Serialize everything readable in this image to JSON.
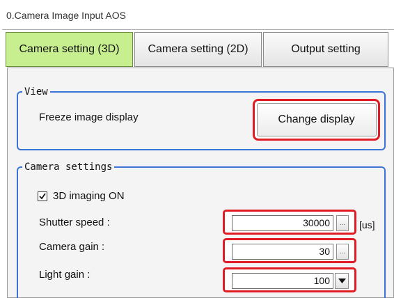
{
  "window": {
    "title": "0.Camera Image Input AOS"
  },
  "tabs": [
    {
      "label": "Camera setting (3D)",
      "active": true
    },
    {
      "label": "Camera setting (2D)",
      "active": false
    },
    {
      "label": "Output setting",
      "active": false
    }
  ],
  "view": {
    "legend": "View",
    "freeze_label": "Freeze image display",
    "change_display_label": "Change display"
  },
  "camera_settings": {
    "legend": "Camera settings",
    "imaging_3d_label": "3D imaging ON",
    "imaging_3d_checked": true,
    "shutter_speed_label": "Shutter speed :",
    "shutter_speed_value": "30000",
    "shutter_speed_unit": "[us]",
    "shutter_speed_button": "...",
    "camera_gain_label": "Camera gain :",
    "camera_gain_value": "30",
    "camera_gain_button": "...",
    "light_gain_label": "Light gain :",
    "light_gain_value": "100"
  },
  "colors": {
    "active_tab": "#c7ef8f",
    "group_border": "#3a74d8",
    "highlight": "#e01b23"
  },
  "icons": {
    "checkbox": "checkmark-icon",
    "dropdown": "chevron-down-icon"
  }
}
